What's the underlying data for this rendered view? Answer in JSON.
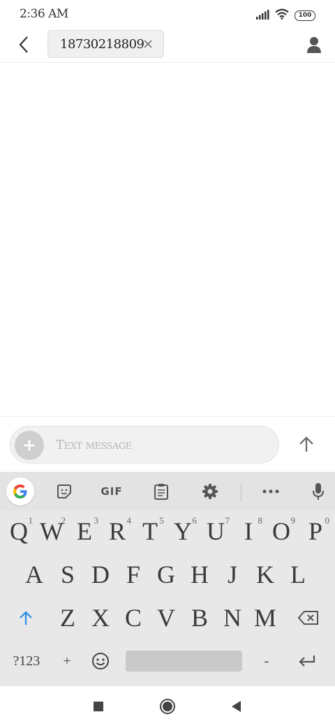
{
  "status_bar": {
    "time": "2:36 AM",
    "battery": "100",
    "icons": [
      "signal-icon",
      "wifi-icon",
      "battery-icon"
    ]
  },
  "header": {
    "recipient": "18730218809",
    "icons": [
      "back-arrow-icon",
      "close-icon",
      "contact-icon"
    ]
  },
  "compose": {
    "placeholder": "Text message",
    "icons": [
      "plus-icon",
      "send-arrow-icon"
    ]
  },
  "keyboard": {
    "toolbar_gif": "GIF",
    "toolbar_icons": [
      "google-icon",
      "sticker-icon",
      "gif-icon",
      "clipboard-icon",
      "settings-icon",
      "more-icon",
      "mic-icon"
    ],
    "row1": [
      {
        "k": "Q",
        "h": "1"
      },
      {
        "k": "W",
        "h": "2"
      },
      {
        "k": "E",
        "h": "3"
      },
      {
        "k": "R",
        "h": "4"
      },
      {
        "k": "T",
        "h": "5"
      },
      {
        "k": "Y",
        "h": "6"
      },
      {
        "k": "U",
        "h": "7"
      },
      {
        "k": "I",
        "h": "8"
      },
      {
        "k": "O",
        "h": "9"
      },
      {
        "k": "P",
        "h": "0"
      }
    ],
    "row2": [
      "A",
      "S",
      "D",
      "F",
      "G",
      "H",
      "J",
      "K",
      "L"
    ],
    "row3": [
      "Z",
      "X",
      "C",
      "V",
      "B",
      "N",
      "M"
    ],
    "row4": {
      "symbols": "?123",
      "plus": "+",
      "dash": "-"
    },
    "accent_color": "#2a8ae6"
  },
  "nav_bar": {
    "icons": [
      "recents-square-icon",
      "home-circle-icon",
      "back-triangle-icon"
    ]
  }
}
